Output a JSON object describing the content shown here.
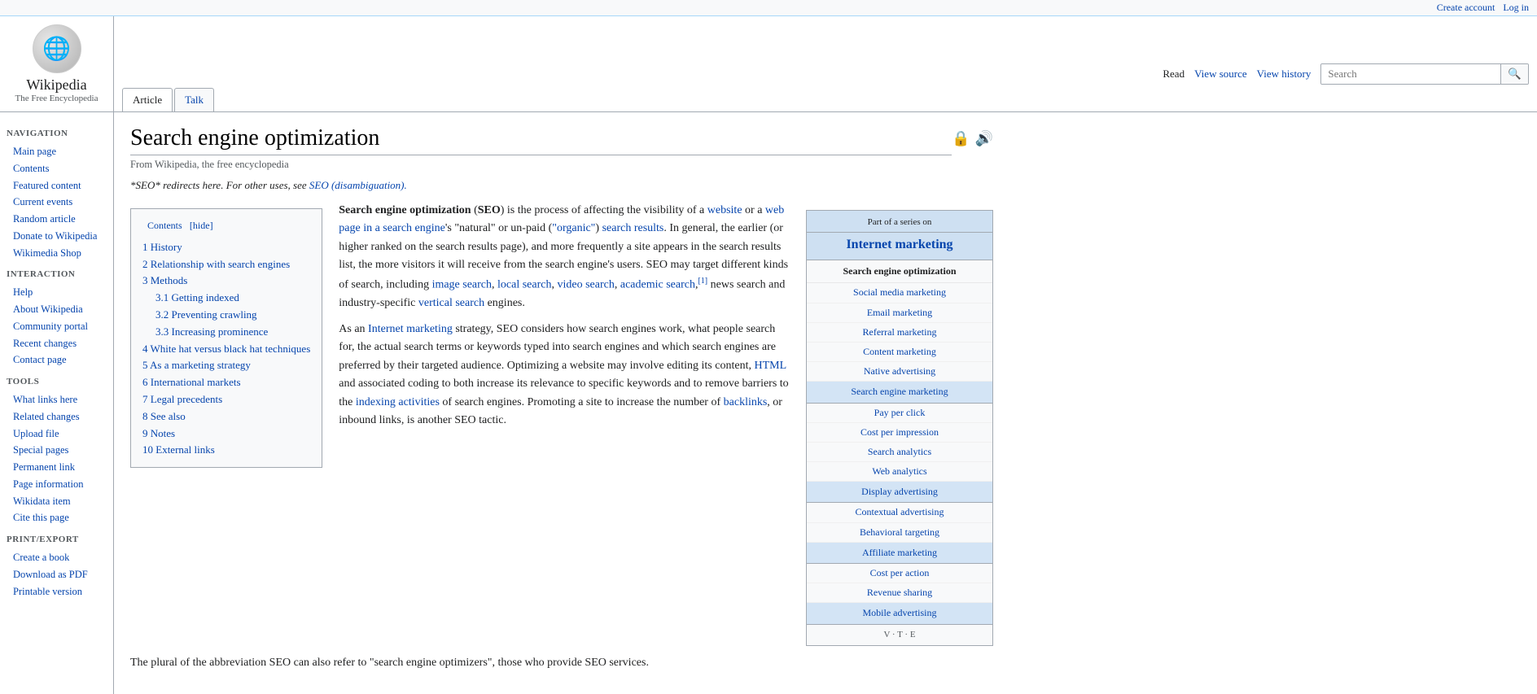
{
  "topbar": {
    "create_account": "Create account",
    "log_in": "Log in"
  },
  "logo": {
    "title": "Wikipedia",
    "subtitle": "The Free Encyclopedia"
  },
  "tabs": {
    "article": "Article",
    "talk": "Talk"
  },
  "right_tabs": {
    "read": "Read",
    "view_source": "View source",
    "view_history": "View history"
  },
  "search": {
    "placeholder": "Search",
    "button_label": "🔍"
  },
  "sidebar": {
    "navigation_title": "Navigation",
    "nav_links": [
      {
        "label": "Main page",
        "href": "#"
      },
      {
        "label": "Contents",
        "href": "#"
      },
      {
        "label": "Featured content",
        "href": "#"
      },
      {
        "label": "Current events",
        "href": "#"
      },
      {
        "label": "Random article",
        "href": "#"
      },
      {
        "label": "Donate to Wikipedia",
        "href": "#"
      },
      {
        "label": "Wikimedia Shop",
        "href": "#"
      }
    ],
    "interaction_title": "Interaction",
    "interaction_links": [
      {
        "label": "Help",
        "href": "#"
      },
      {
        "label": "About Wikipedia",
        "href": "#"
      },
      {
        "label": "Community portal",
        "href": "#"
      },
      {
        "label": "Recent changes",
        "href": "#"
      },
      {
        "label": "Contact page",
        "href": "#"
      }
    ],
    "tools_title": "Tools",
    "tools_links": [
      {
        "label": "What links here",
        "href": "#"
      },
      {
        "label": "Related changes",
        "href": "#"
      },
      {
        "label": "Upload file",
        "href": "#"
      },
      {
        "label": "Special pages",
        "href": "#"
      },
      {
        "label": "Permanent link",
        "href": "#"
      },
      {
        "label": "Page information",
        "href": "#"
      },
      {
        "label": "Wikidata item",
        "href": "#"
      },
      {
        "label": "Cite this page",
        "href": "#"
      }
    ],
    "printexport_title": "Print/export",
    "printexport_links": [
      {
        "label": "Create a book",
        "href": "#"
      },
      {
        "label": "Download as PDF",
        "href": "#"
      },
      {
        "label": "Printable version",
        "href": "#"
      }
    ]
  },
  "page": {
    "title": "Search engine optimization",
    "from_wikipedia": "From Wikipedia, the free encyclopedia",
    "redirect_note": "*SEO* redirects here. For other uses, see",
    "redirect_link_text": "SEO (disambiguation).",
    "intro_paragraph": "Search engine optimization (SEO) is the process of affecting the visibility of a website or a web page in a search engine's \"natural\" or un-paid (\"organic\") search results. In general, the earlier (or higher ranked on the search results page), and more frequently a site appears in the search results list, the more visitors it will receive from the search engine's users. SEO may target different kinds of search, including image search, local search, video search, academic search,[1] news search and industry-specific vertical search engines.",
    "para2": "As an Internet marketing strategy, SEO considers how search engines work, what people search for, the actual search terms or keywords typed into search engines and which search engines are preferred by their targeted audience. Optimizing a website may involve editing its content, HTML and associated coding to both increase its relevance to specific keywords and to remove barriers to the indexing activities of search engines. Promoting a site to increase the number of backlinks, or inbound links, is another SEO tactic.",
    "para3": "The plural of the abbreviation SEO can also refer to \"search engine optimizers\", those who provide SEO services.",
    "contents": {
      "header": "Contents",
      "hide_label": "[hide]",
      "items": [
        {
          "num": "1",
          "label": "History",
          "href": "#"
        },
        {
          "num": "2",
          "label": "Relationship with search engines",
          "href": "#"
        },
        {
          "num": "3",
          "label": "Methods",
          "href": "#"
        },
        {
          "num": "3.1",
          "label": "Getting indexed",
          "href": "#",
          "sub": true
        },
        {
          "num": "3.2",
          "label": "Preventing crawling",
          "href": "#",
          "sub": true
        },
        {
          "num": "3.3",
          "label": "Increasing prominence",
          "href": "#",
          "sub": true
        },
        {
          "num": "4",
          "label": "White hat versus black hat techniques",
          "href": "#"
        },
        {
          "num": "5",
          "label": "As a marketing strategy",
          "href": "#"
        },
        {
          "num": "6",
          "label": "International markets",
          "href": "#"
        },
        {
          "num": "7",
          "label": "Legal precedents",
          "href": "#"
        },
        {
          "num": "8",
          "label": "See also",
          "href": "#"
        },
        {
          "num": "9",
          "label": "Notes",
          "href": "#"
        },
        {
          "num": "10",
          "label": "External links",
          "href": "#"
        }
      ]
    }
  },
  "infobox": {
    "part_of_series": "Part of a series on",
    "title": "Internet marketing",
    "seo_section": "Search engine optimization",
    "links": [
      {
        "label": "Social media marketing",
        "highlight": false
      },
      {
        "label": "Email marketing",
        "highlight": false
      },
      {
        "label": "Referral marketing",
        "highlight": false
      },
      {
        "label": "Content marketing",
        "highlight": false
      },
      {
        "label": "Native advertising",
        "highlight": false
      }
    ],
    "sem_section": "Search engine marketing",
    "sem_links": [
      {
        "label": "Pay per click",
        "highlight": false
      },
      {
        "label": "Cost per impression",
        "highlight": false
      },
      {
        "label": "Search analytics",
        "highlight": false
      },
      {
        "label": "Web analytics",
        "highlight": false
      }
    ],
    "display_section": "Display advertising",
    "display_links": [
      {
        "label": "Contextual advertising",
        "highlight": false
      },
      {
        "label": "Behavioral targeting",
        "highlight": false
      }
    ],
    "affiliate_section": "Affiliate marketing",
    "affiliate_links": [
      {
        "label": "Cost per action",
        "highlight": false
      },
      {
        "label": "Revenue sharing",
        "highlight": false
      }
    ],
    "mobile_section": "Mobile advertising",
    "footer": "V · T · E"
  }
}
